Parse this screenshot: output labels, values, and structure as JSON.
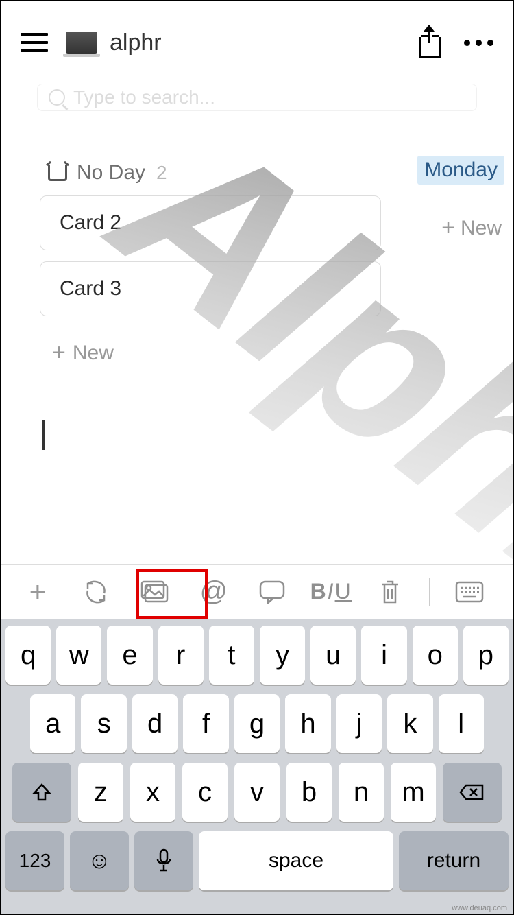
{
  "header": {
    "title": "alphr"
  },
  "search": {
    "placeholder": "Type to search..."
  },
  "section": {
    "label": "No Day",
    "count": "2",
    "badge": "Monday"
  },
  "cards": [
    "Card 2",
    "Card 3"
  ],
  "new_label": "New",
  "toolbar": {
    "format": "BIU"
  },
  "keyboard": {
    "row1": [
      "q",
      "w",
      "e",
      "r",
      "t",
      "y",
      "u",
      "i",
      "o",
      "p"
    ],
    "row2": [
      "a",
      "s",
      "d",
      "f",
      "g",
      "h",
      "j",
      "k",
      "l"
    ],
    "row3": [
      "z",
      "x",
      "c",
      "v",
      "b",
      "n",
      "m"
    ],
    "numbers": "123",
    "space": "space",
    "return": "return"
  },
  "attribution": "www.deuaq.com"
}
